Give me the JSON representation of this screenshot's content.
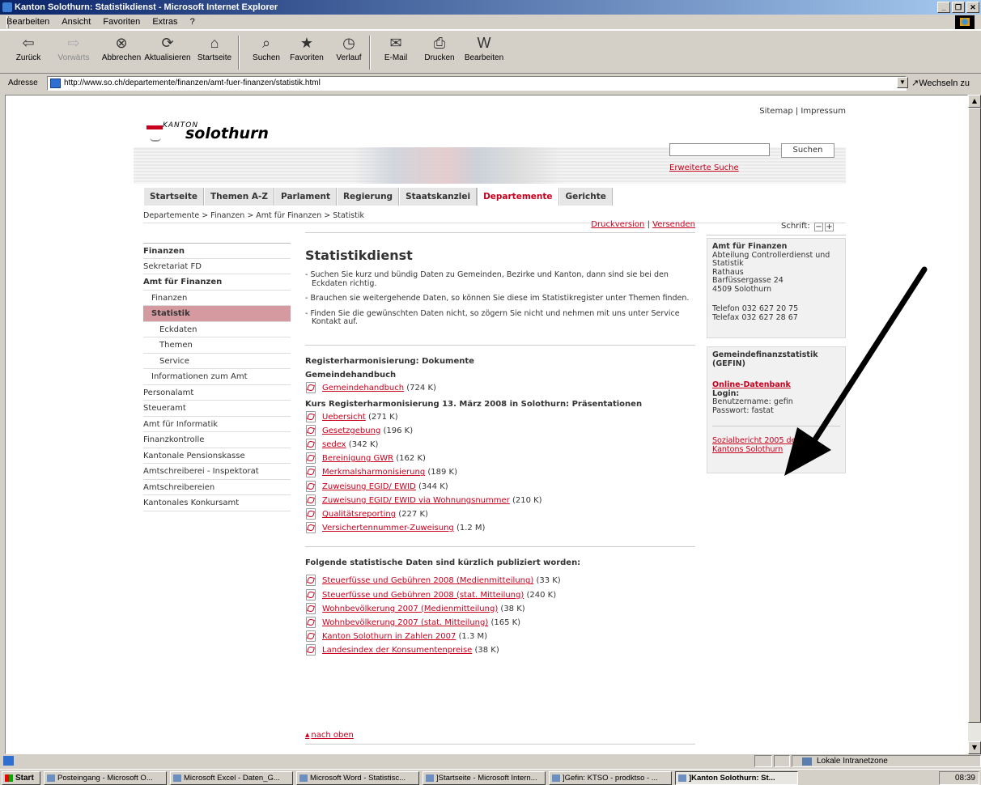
{
  "window": {
    "title": "Kanton Solothurn: Statistikdienst - Microsoft Internet Explorer",
    "buttons": [
      "_",
      "❐",
      "✕"
    ]
  },
  "menu": [
    "Bearbeiten",
    "Ansicht",
    "Favoriten",
    "Extras",
    "?"
  ],
  "toolbar": {
    "back": "Zurück",
    "forward": "Vorwärts",
    "stop": "Abbrechen",
    "refresh": "Aktualisieren",
    "home": "Startseite",
    "search": "Suchen",
    "favorites": "Favoriten",
    "history": "Verlauf",
    "mail": "E-Mail",
    "print": "Drucken",
    "edit": "Bearbeiten"
  },
  "address": {
    "label": "Adresse",
    "url": "http://www.so.ch/departemente/finanzen/amt-fuer-finanzen/statistik.html",
    "go": "Wechseln zu"
  },
  "site": {
    "toplinks": [
      "Sitemap",
      "Impressum"
    ],
    "logo_kanton": "KANTON",
    "logo_name": "solothurn",
    "search_button": "Suchen",
    "search_value": "",
    "advanced_search": "Erweiterte Suche",
    "nav": [
      "Startseite",
      "Themen A-Z",
      "Parlament",
      "Regierung",
      "Staatskanzlei",
      "Departemente",
      "Gerichte"
    ],
    "breadcrumb": "Departemente > Finanzen > Amt für Finanzen > Statistik"
  },
  "leftnav": [
    "Finanzen",
    "Sekretariat FD",
    "Amt für Finanzen",
    "Finanzen",
    "Statistik",
    "Eckdaten",
    "Themen",
    "Service",
    "Informationen zum Amt",
    "Personalamt",
    "Steueramt",
    "Amt für Informatik",
    "Finanzkontrolle",
    "Kantonale Pensionskasse",
    "Amtschreiberei - Inspektorat",
    "Amtschreibereien",
    "Kantonales Konkursamt"
  ],
  "main": {
    "print_version": "Druckversion",
    "send": "Versenden",
    "title": "Statistikdienst",
    "paragraphs": [
      "- Suchen Sie kurz und bündig Daten zu Gemeinden, Bezirke und Kanton, dann sind sie bei den Eckdaten richtig.",
      "- Brauchen sie weitergehende Daten, so können Sie diese im Statistikregister unter Themen finden.",
      "- Finden Sie die gewünschten Daten nicht, so zögern Sie nicht und nehmen mit uns unter Service Kontakt auf."
    ],
    "section_title": "Registerharmonisierung: Dokumente",
    "group1_title": "Gemeindehandbuch",
    "group1": [
      {
        "label": "Gemeindehandbuch",
        "size": "(724 K)"
      }
    ],
    "group2_title": "Kurs Registerharmonisierung 13. März 2008 in Solothurn: Präsentationen",
    "group2": [
      {
        "label": "Uebersicht",
        "size": "(271 K)"
      },
      {
        "label": "Gesetzgebung",
        "size": "(196 K)"
      },
      {
        "label": "sedex",
        "size": "(342 K)"
      },
      {
        "label": "Bereinigung GWR",
        "size": "(162 K)"
      },
      {
        "label": "Merkmalsharmonisierung",
        "size": "(189 K)"
      },
      {
        "label": "Zuweisung EGID/ EWID",
        "size": "(344 K)"
      },
      {
        "label": "Zuweisung EGID/ EWID via Wohnungsnummer",
        "size": "(210 K)"
      },
      {
        "label": "Qualitätsreporting",
        "size": "(227 K)"
      },
      {
        "label": "Versichertennummer-Zuweisung",
        "size": "(1.2 M)"
      }
    ],
    "published_title": "Folgende statistische Daten sind kürzlich publiziert worden:",
    "published": [
      {
        "label": "Steuerfüsse und Gebühren 2008 (Medienmitteilung)",
        "size": "(33 K)"
      },
      {
        "label": "Steuerfüsse und Gebühren 2008 (stat. Mitteilung)",
        "size": "(240 K)"
      },
      {
        "label": "Wohnbevölkerung 2007 (Medienmitteilung)",
        "size": "(38 K)"
      },
      {
        "label": "Wohnbevölkerung 2007 (stat. Mitteilung)",
        "size": "(165 K)"
      },
      {
        "label": "Kanton Solothurn in Zahlen 2007",
        "size": "(1.3 M)"
      },
      {
        "label": "Landesindex der Konsumentenpreise",
        "size": "(38 K)"
      }
    ],
    "to_top": "nach oben"
  },
  "right": {
    "font_label": "Schrift:",
    "font_minus": "−",
    "font_plus": "+",
    "office_title": "Amt für Finanzen",
    "office_lines": [
      "Abteilung Controllerdienst und",
      "Statistik",
      "Rathaus",
      "Barfüssergasse 24",
      "4509 Solothurn"
    ],
    "phone": "Telefon 032 627 20 75",
    "fax": "Telefax 032 627 28 67",
    "gefin_title_1": "Gemeindefinanzstatistik",
    "gefin_title_2": "(GEFIN)",
    "gefin_link": "Online-Datenbank",
    "login_label": "Login:",
    "user": "Benutzername: gefin",
    "pass": "Passwort: fastat",
    "report_link_1": "Sozialbericht 2005 des",
    "report_link_2": "Kantons Solothurn"
  },
  "status": {
    "zone": "Lokale Intranetzone"
  },
  "taskbar": {
    "start": "Start",
    "tasks": [
      "Posteingang - Microsoft O...",
      "Microsoft Excel - Daten_G...",
      "Microsoft Word - Statistisc...",
      "]Startseite - Microsoft Intern...",
      "]Gefin: KTSO - prodktso - ...",
      "]Kanton Solothurn: St..."
    ],
    "clock": "08:39"
  }
}
